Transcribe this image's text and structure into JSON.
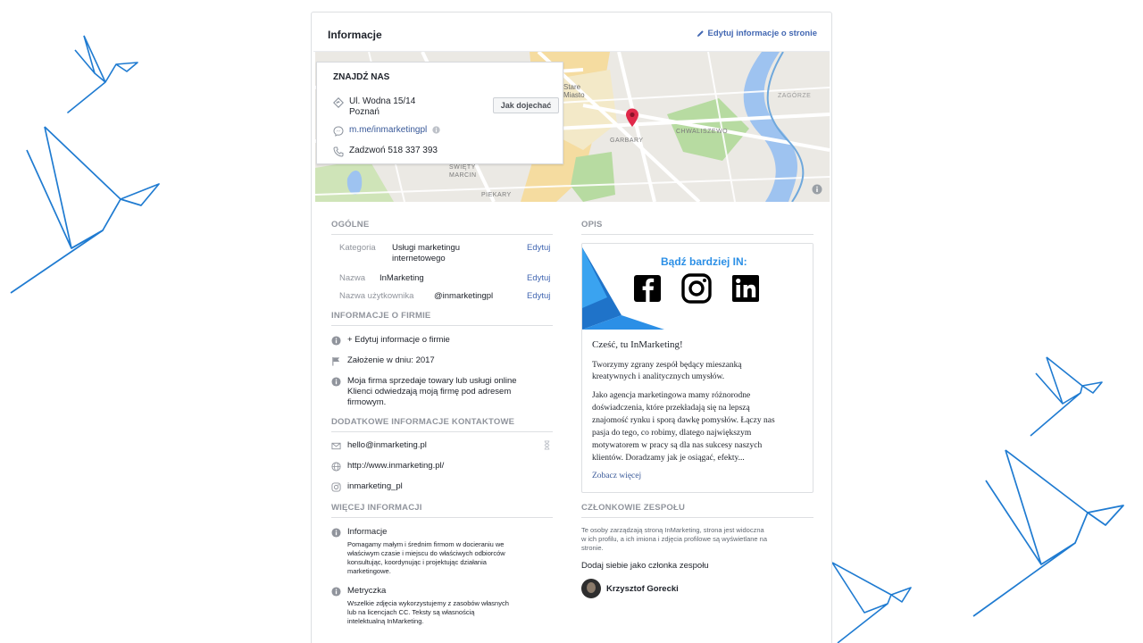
{
  "header": {
    "title": "Informacje",
    "edit_link": "Edytuj informacje o stronie"
  },
  "find_us": {
    "title": "ZNAJDŹ NAS",
    "address_line1": "Ul. Wodna 15/14",
    "address_line2": "Poznań",
    "directions_button": "Jak dojechać",
    "messenger_link": "m.me/inmarketingpl",
    "phone": "Zadzwoń 518 337 393"
  },
  "map": {
    "labels": [
      "Stare",
      "Miasto",
      "GARBARY",
      "CHWALISZEWO",
      "ZAGÓRZE",
      "ŚWIĘTY",
      "MARCIN",
      "PIEKARY"
    ]
  },
  "general": {
    "title": "OGÓLNE",
    "rows": [
      {
        "label": "Kategoria",
        "value_line1": "Usługi marketingu",
        "value_line2": "internetowego",
        "edit": "Edytuj"
      },
      {
        "label": "Nazwa",
        "value_line1": "InMarketing",
        "edit": "Edytuj"
      },
      {
        "label": "Nazwa użytkownika",
        "value_line1": "@inmarketingpl",
        "edit": "Edytuj"
      }
    ]
  },
  "company_info": {
    "title": "INFORMACJE O FIRMIE",
    "edit_link": "+ Edytuj informacje o firmie",
    "founded": "Założenie w dniu: 2017",
    "desc_line1": "Moja firma sprzedaje towary lub usługi online",
    "desc_line2": "Klienci odwiedzają moją firmę pod adresem",
    "desc_line3": "firmowym."
  },
  "contact": {
    "title": "DODATKOWE INFORMACJE KONTAKTOWE",
    "email": "hello@inmarketing.pl",
    "website": "http://www.inmarketing.pl/",
    "instagram": "inmarketing_pl"
  },
  "more_info": {
    "title": "WIĘCEJ INFORMACJI",
    "about_title": "Informacje",
    "about_lines": [
      "Pomagamy małym i średnim firmom w docieraniu we",
      "właściwym czasie i miejscu do właściwych odbiorców",
      "konsultując, koordynując i projektując działania",
      "marketingowe."
    ],
    "imprint_title": "Metryczka",
    "imprint_lines": [
      "Wszelkie zdjęcia wykorzystujemy z zasobów własnych",
      "lub na licencjach CC. Teksty są własnością",
      "intelektualną InMarketing."
    ]
  },
  "description": {
    "title": "OPIS",
    "banner_text": "Bądź bardziej IN:",
    "greeting": "Cześć, tu InMarketing!",
    "para1_lines": [
      "Tworzymy zgrany zespół będący mieszanką",
      "kreatywnych i analitycznych umysłów."
    ],
    "para2_lines": [
      "Jako agencja marketingowa mamy różnorodne",
      "doświadczenia, które przekładają się na lepszą",
      "znajomość rynku i sporą dawkę pomysłów. Łączy nas",
      "pasja do tego, co robimy, dlatego największym",
      "motywatorem w pracy są dla nas sukcesy naszych",
      "klientów. Doradzamy jak je osiągać, efekty..."
    ],
    "see_more": "Zobacz więcej"
  },
  "team": {
    "title": "CZŁONKOWIE ZESPOŁU",
    "desc_lines": [
      "Te osoby zarządzają stroną InMarketing, strona jest widoczna",
      "w ich profilu, a ich imiona i zdjęcia profilowe są wyświetlane na",
      "stronie."
    ],
    "add_link": "Dodaj siebie jako członka zespołu",
    "member": "Krzysztof Gorecki"
  },
  "colors": {
    "link": "#385898",
    "accent": "#4267b2",
    "bird_stroke": "#1f7bd1",
    "pin": "#e0294a"
  }
}
